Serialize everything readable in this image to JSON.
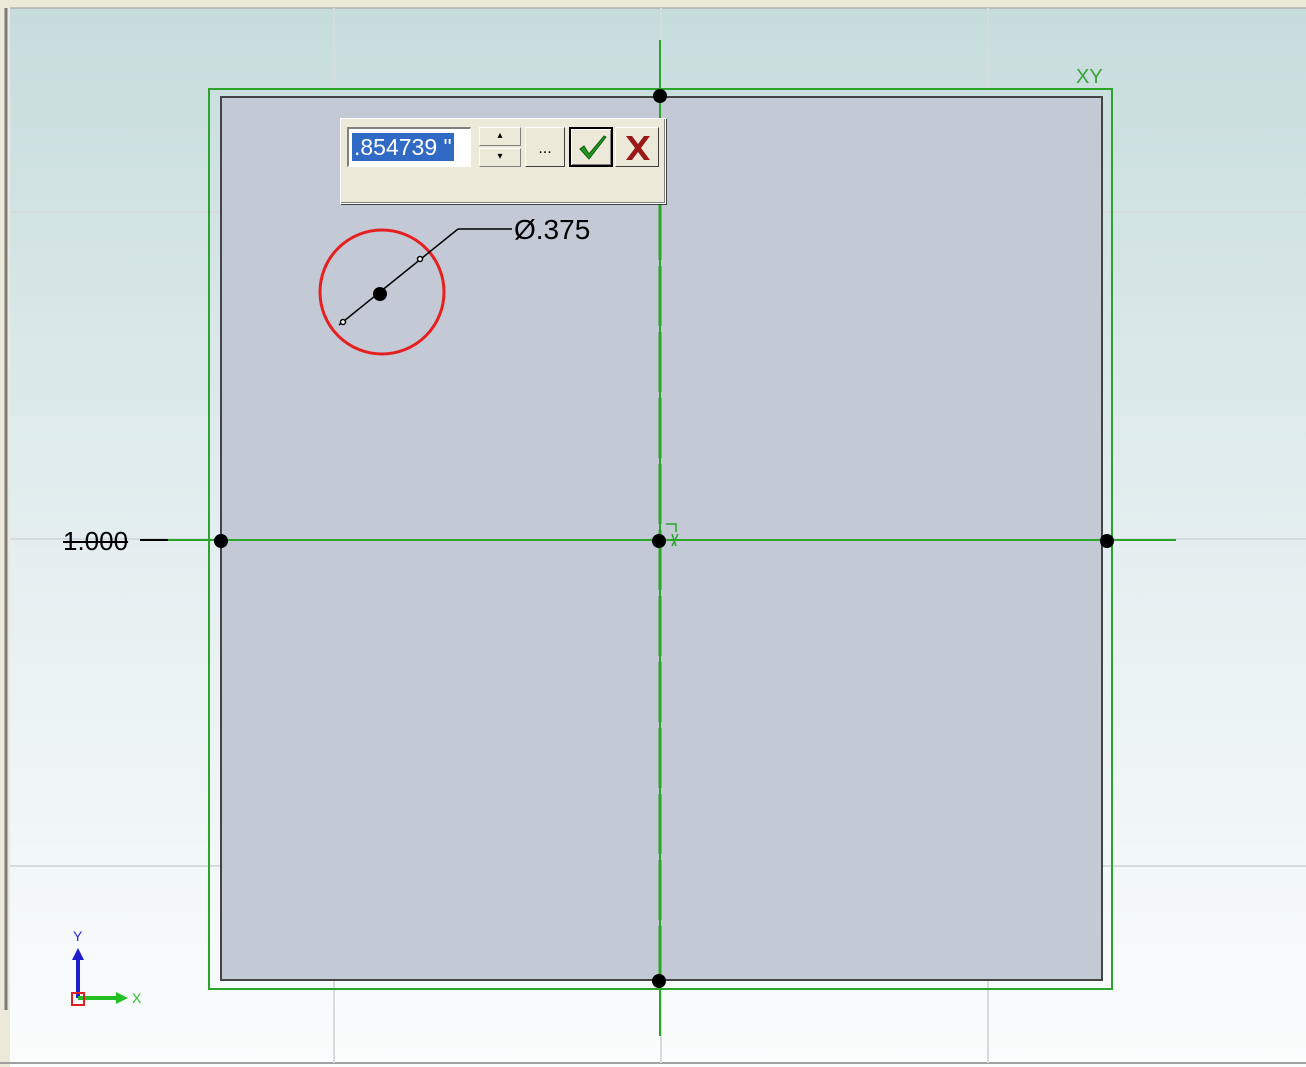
{
  "dimension_input": {
    "value": ".854739 \""
  },
  "spinner": {
    "up_symbol": "▴",
    "down_symbol": "▾"
  },
  "more_button": {
    "label": "..."
  },
  "annotations": {
    "diameter": "Ø.375",
    "horizontal_dimension": "1.000",
    "sketch_plane": "XY"
  },
  "triad": {
    "y_label": "Y",
    "x_label": "X"
  },
  "colors": {
    "sketch_green": "#2aa52a",
    "circle_red": "#e62020",
    "plate_fill": "#c3cad6",
    "confirm_green": "#1f9a1f",
    "cancel_red": "#9a1a1a"
  },
  "icons": {
    "confirm": "check-icon",
    "cancel": "x-icon",
    "triad": "axis-triad-icon"
  }
}
